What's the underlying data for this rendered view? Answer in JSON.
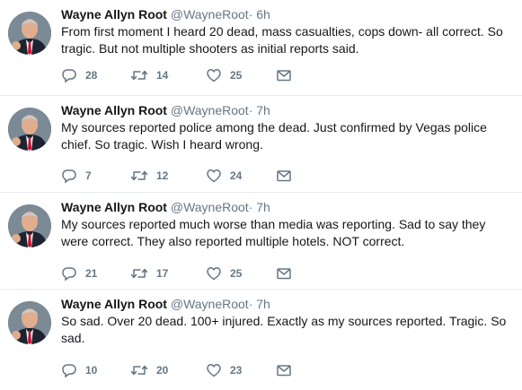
{
  "tweets": [
    {
      "name": "Wayne Allyn Root",
      "handle": "@WayneRoot",
      "dot": "·",
      "time": "6h",
      "text": "From first moment I heard 20 dead, mass casualties, cops down- all correct. So tragic. But not multiple shooters as initial reports said.",
      "replies": "28",
      "retweets": "14",
      "likes": "25"
    },
    {
      "name": "Wayne Allyn Root",
      "handle": "@WayneRoot",
      "dot": "·",
      "time": "7h",
      "text": "My sources reported police among the dead. Just confirmed by Vegas police chief. So tragic. Wish I heard wrong.",
      "replies": "7",
      "retweets": "12",
      "likes": "24"
    },
    {
      "name": "Wayne Allyn Root",
      "handle": "@WayneRoot",
      "dot": "·",
      "time": "7h",
      "text": "My sources reported much worse than media was reporting. Sad to say they were correct. They also reported multiple hotels. NOT correct.",
      "replies": "21",
      "retweets": "17",
      "likes": "25"
    },
    {
      "name": "Wayne Allyn Root",
      "handle": "@WayneRoot",
      "dot": "·",
      "time": "7h",
      "text": "So sad. Over 20 dead. 100+ injured. Exactly as my sources reported. Tragic. So sad.",
      "replies": "10",
      "retweets": "20",
      "likes": "23"
    }
  ],
  "colors": {
    "text": "#14171a",
    "secondary": "#657786",
    "divider": "#e6ecf0",
    "tie": "#c8102e"
  },
  "icons": [
    "reply-icon",
    "retweet-icon",
    "like-icon",
    "direct-message-icon"
  ]
}
